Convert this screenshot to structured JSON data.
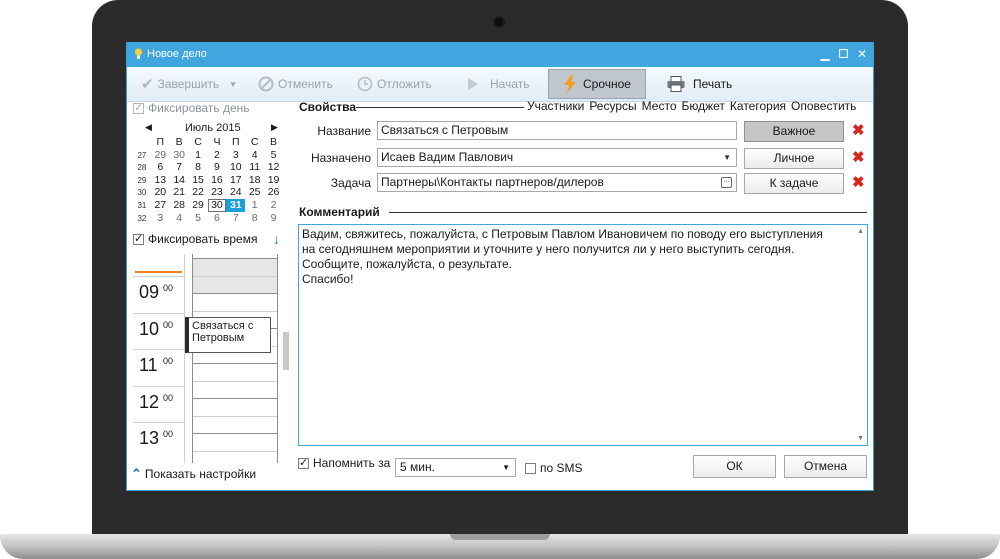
{
  "window": {
    "title": "Новое дело"
  },
  "toolbar": {
    "complete": "Завершить",
    "cancel": "Отменить",
    "postpone": "Отложить",
    "start": "Начать",
    "urgent": "Срочное",
    "print": "Печать"
  },
  "left": {
    "fix_day": "Фиксировать день",
    "calendar": {
      "month": "Июль 2015",
      "weekdays": [
        "П",
        "В",
        "С",
        "Ч",
        "П",
        "С",
        "В"
      ],
      "weeks": [
        {
          "num": "27",
          "days": [
            "29",
            "30",
            "1",
            "2",
            "3",
            "4",
            "5"
          ]
        },
        {
          "num": "28",
          "days": [
            "6",
            "7",
            "8",
            "9",
            "10",
            "11",
            "12"
          ]
        },
        {
          "num": "29",
          "days": [
            "13",
            "14",
            "15",
            "16",
            "17",
            "18",
            "19"
          ]
        },
        {
          "num": "30",
          "days": [
            "20",
            "21",
            "22",
            "23",
            "24",
            "25",
            "26"
          ]
        },
        {
          "num": "31",
          "days": [
            "27",
            "28",
            "29",
            "30",
            "31",
            "1",
            "2"
          ]
        },
        {
          "num": "32",
          "days": [
            "3",
            "4",
            "5",
            "6",
            "7",
            "8",
            "9"
          ]
        }
      ]
    },
    "fix_time": "Фиксировать время",
    "hours": [
      {
        "h": "09",
        "m": "00"
      },
      {
        "h": "10",
        "m": "00"
      },
      {
        "h": "11",
        "m": "00"
      },
      {
        "h": "12",
        "m": "00"
      },
      {
        "h": "13",
        "m": "00"
      }
    ],
    "event": "Связаться с Петровым",
    "show_settings": "Показать настройки"
  },
  "properties": {
    "title": "Свойства",
    "tabs": [
      "Участники",
      "Ресурсы",
      "Место",
      "Бюджет",
      "Категория",
      "Оповестить"
    ],
    "name_label": "Название",
    "name_value": "Связаться с Петровым",
    "name_button": "Важное",
    "assigned_label": "Назначено",
    "assigned_value": "Исаев Вадим Павлович",
    "assigned_button": "Личное",
    "task_label": "Задача",
    "task_value": "Партнеры\\Контакты партнеров/дилеров",
    "task_button": "К задаче"
  },
  "comment": {
    "title": "Комментарий",
    "text": "Вадим, свяжитесь, пожалуйста, с Петровым Павлом Ивановичем по поводу его выступления\nна сегодняшнем мероприятии и уточните у него получится ли у него выступить сегодня.\nСообщите, пожалуйста, о результате.\nСпасибо!"
  },
  "footer": {
    "remind_label": "Напомнить за",
    "remind_value": "5 мин.",
    "sms_label": "по SMS",
    "ok": "ОК",
    "cancel": "Отмена"
  }
}
